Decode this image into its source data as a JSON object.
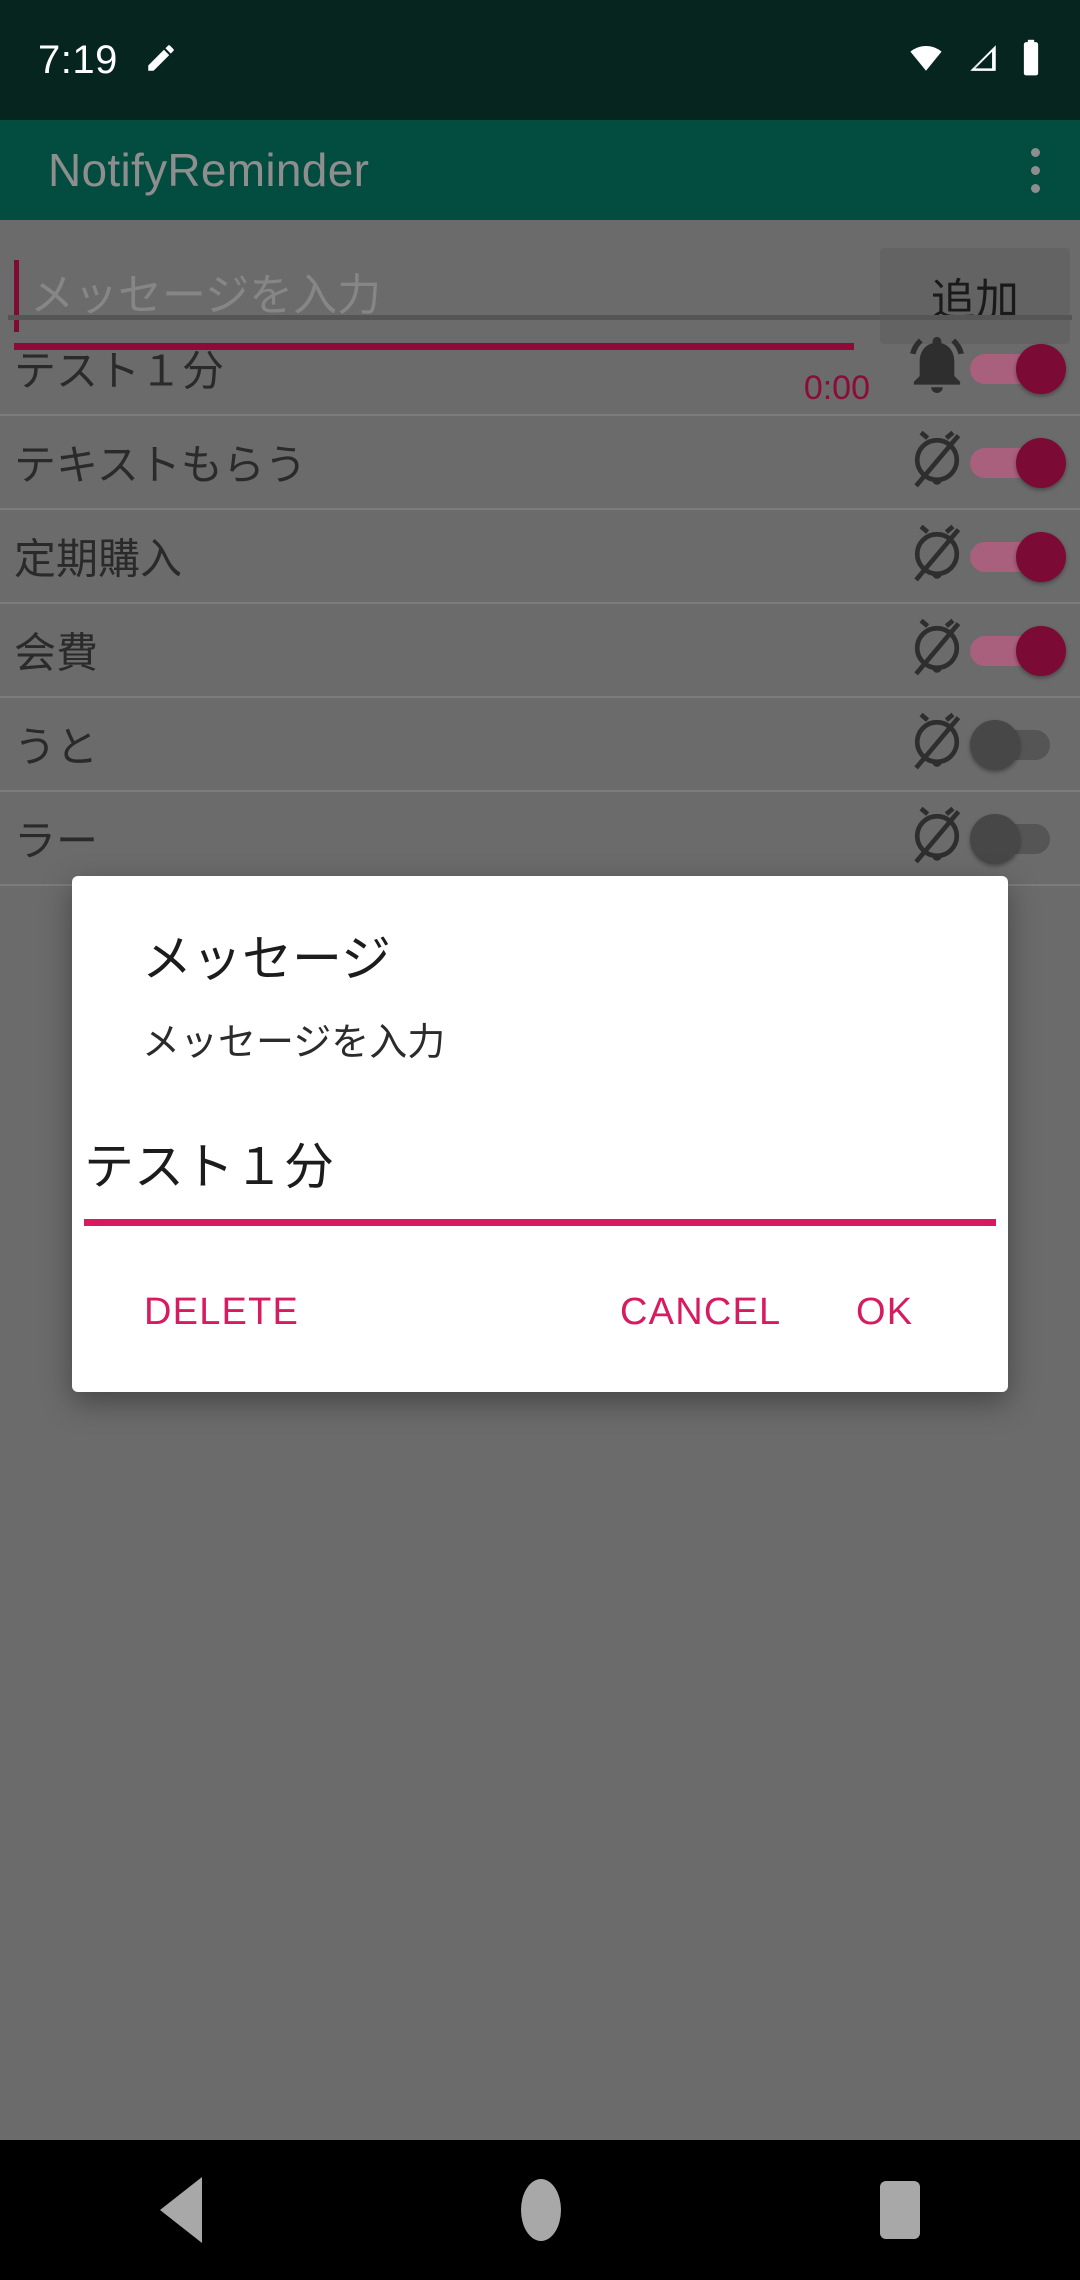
{
  "status_bar": {
    "time": "7:19",
    "icons": [
      "pencil-icon",
      "wifi-icon",
      "cellular-signal-icon",
      "battery-icon"
    ]
  },
  "app_bar": {
    "title": "NotifyReminder",
    "overflow_label": "more-options"
  },
  "add_row": {
    "placeholder": "メッセージを入力",
    "value": "",
    "button_label": "追加"
  },
  "reminders": [
    {
      "label": "テスト１分",
      "timer": "0:00",
      "bell": "alarm-on",
      "enabled": true
    },
    {
      "label": "テキストもらう",
      "timer": "",
      "bell": "alarm-off",
      "enabled": true
    },
    {
      "label": "定期購入",
      "timer": "",
      "bell": "alarm-off",
      "enabled": true
    },
    {
      "label": "会費",
      "timer": "",
      "bell": "alarm-off",
      "enabled": true
    },
    {
      "label": "うと",
      "timer": "",
      "bell": "alarm-off",
      "enabled": false
    },
    {
      "label": "ラー",
      "timer": "",
      "bell": "alarm-off",
      "enabled": false
    }
  ],
  "dialog": {
    "title": "メッセージ",
    "subtitle": "メッセージを入力",
    "input_value": "テスト１分",
    "buttons": {
      "delete": "DELETE",
      "cancel": "CANCEL",
      "ok": "OK"
    }
  },
  "nav_bar": {
    "back": "back-button",
    "home": "home-button",
    "recents": "recents-button"
  },
  "colors": {
    "status_bar_bg": "#06251f",
    "app_bar_bg": "#024d40",
    "scrim": "#6b6b6b",
    "accent_pink": "#d81b60",
    "accent_crimson": "#8c0b38",
    "toggle_on": "#7b0a34",
    "nav_bg": "#000000"
  }
}
